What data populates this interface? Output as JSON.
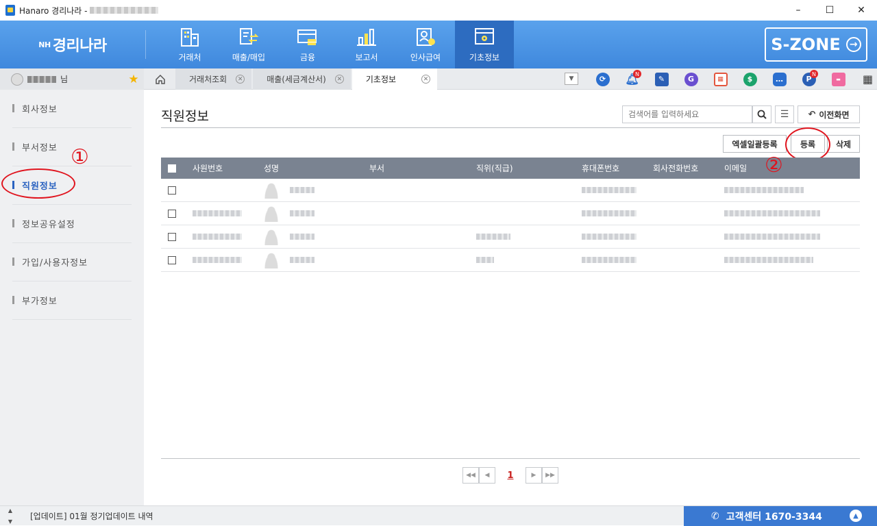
{
  "window": {
    "title": "Hanaro 경리나라 -",
    "controls": {
      "minimize": "–",
      "maximize": "☐",
      "close": "✕"
    }
  },
  "brand": {
    "prefix": "NH",
    "name": "경리나라"
  },
  "menu": [
    {
      "label": "거래처",
      "icon": "building-icon"
    },
    {
      "label": "매출/매입",
      "icon": "exchange-doc-icon"
    },
    {
      "label": "금융",
      "icon": "card-coin-icon"
    },
    {
      "label": "보고서",
      "icon": "bar-chart-icon"
    },
    {
      "label": "인사급여",
      "icon": "person-card-icon"
    },
    {
      "label": "기초정보",
      "icon": "settings-window-icon"
    }
  ],
  "szone": {
    "label": "S-ZONE"
  },
  "user": {
    "suffix": "님"
  },
  "tabs": [
    {
      "label": "거래처조회"
    },
    {
      "label": "매출(세금계산서)"
    },
    {
      "label": "기초정보"
    }
  ],
  "sidebar": {
    "items": [
      {
        "label": "회사정보"
      },
      {
        "label": "부서정보"
      },
      {
        "label": "직원정보"
      },
      {
        "label": "정보공유설정"
      },
      {
        "label": "가입/사용자정보"
      },
      {
        "label": "부가정보"
      }
    ]
  },
  "annotations": {
    "one": "①",
    "two": "②"
  },
  "page": {
    "title": "직원정보",
    "search_placeholder": "검색어를 입력하세요",
    "back_label": "이전화면",
    "excel_label": "엑셀일괄등록",
    "register_label": "등록",
    "delete_label": "삭제"
  },
  "table": {
    "headers": [
      "사원번호",
      "성명",
      "부서",
      "직위(직급)",
      "휴대폰번호",
      "회사전화번호",
      "이메일"
    ],
    "row_count": 4
  },
  "pagination": {
    "current": "1"
  },
  "statusbar": {
    "notice": "[업데이트] 01월 정기업데이트 내역",
    "cs_label": "고객센터 1670-3344"
  },
  "colors": {
    "primary": "#3f88dd",
    "active_menu": "#2d6cc0",
    "annotation": "#e0141e",
    "header_row": "#7a8391"
  }
}
